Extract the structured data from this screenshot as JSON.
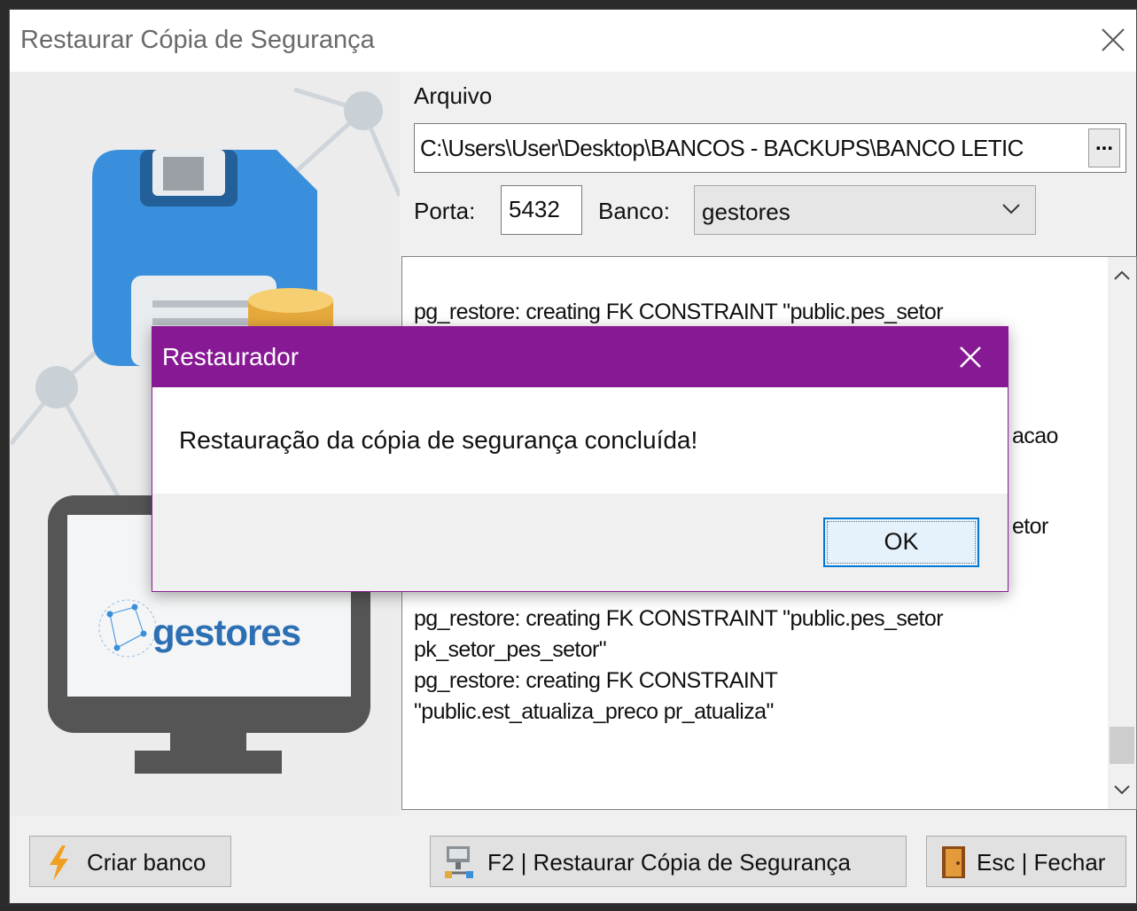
{
  "main_window": {
    "title": "Restaurar Cópia de Segurança",
    "close_glyph": "✕"
  },
  "illustration": {
    "logo_text": "gestores"
  },
  "form": {
    "file_label": "Arquivo",
    "file_value": "C:\\Users\\User\\Desktop\\BANCOS - BACKUPS\\BANCO LETIC",
    "browse_label": "...",
    "port_label": "Porta:",
    "port_value": "5432",
    "db_label": "Banco:",
    "db_value": "gestores"
  },
  "log": {
    "lines_top": [
      "pg_restore: creating FK CONSTRAINT \"public.pes_setor"
    ],
    "line_fragments": [
      "acao",
      "etor"
    ],
    "lines_bottom": [
      "pg_restore: creating FK CONSTRAINT \"public.pes_setor",
      "pk_setor_pes_setor\"",
      "pg_restore: creating FK CONSTRAINT",
      "\"public.est_atualiza_preco pr_atualiza\""
    ]
  },
  "buttons": {
    "create_db": "Criar banco",
    "restore": "F2 | Restaurar Cópia de Segurança",
    "close": "Esc | Fechar"
  },
  "modal": {
    "title": "Restaurador",
    "message": "Restauração da cópia de segurança concluída!",
    "ok_label": "OK"
  },
  "colors": {
    "modal_titlebar": "#871a94",
    "floppy_blue": "#3a8fdc",
    "monitor_gray": "#555555"
  }
}
